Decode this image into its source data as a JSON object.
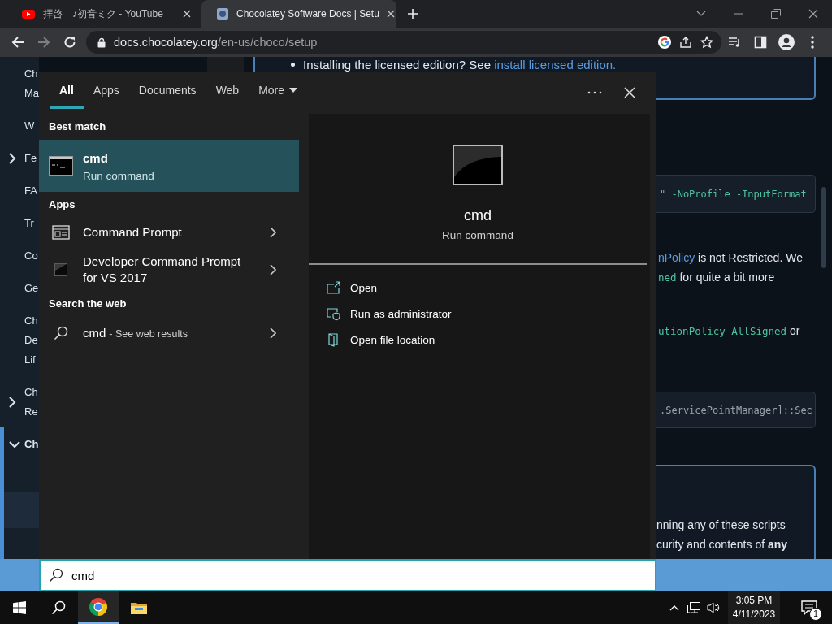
{
  "browser": {
    "tabs": [
      {
        "title": "拝啓　♪初音ミク - YouTube",
        "selected": false
      },
      {
        "title": "Chocolatey Software Docs | Setu",
        "selected": true
      }
    ],
    "forward_disabled": true,
    "address": {
      "host": "docs.chocolatey.org",
      "path": "/en-us/choco/setup"
    }
  },
  "page": {
    "sidebar": [
      {
        "lines": [
          "Ch",
          "Ma"
        ]
      },
      {
        "lines": [
          "W"
        ]
      },
      {
        "lines": [
          "Fe"
        ],
        "expanded": false
      },
      {
        "lines": [
          "FA"
        ]
      },
      {
        "lines": [
          "Tr"
        ]
      },
      {
        "lines": [
          "Co"
        ]
      },
      {
        "lines": [
          "Ge"
        ]
      },
      {
        "lines": [
          "Ch",
          "De",
          "Lif"
        ]
      },
      {
        "lines": [
          "Ch",
          "Re"
        ],
        "expanded": false
      },
      {
        "lines": [
          "Ch"
        ],
        "expanded": true
      }
    ],
    "bullet": [
      {
        "text": "Installing the licensed edition? See ",
        "kind": "plain"
      },
      {
        "text": "install licensed edition.",
        "kind": "link"
      }
    ],
    "blocks": [
      {
        "kind": "callout_end"
      },
      {
        "kind": "code",
        "text": "\" -NoProfile -InputFormat",
        "dim": false
      },
      {
        "kind": "paragraph",
        "lines": [
          [
            {
              "text": "nPolicy",
              "kind": "link"
            },
            {
              "text": " is not Restricted. We",
              "kind": "plain"
            }
          ],
          [
            {
              "text": "ned",
              "kind": "code"
            },
            {
              "text": " for quite a bit more",
              "kind": "plain"
            }
          ]
        ]
      },
      {
        "kind": "paragraph",
        "lines": [
          [
            {
              "text": "utionPolicy AllSigned",
              "kind": "code"
            },
            {
              "text": " or",
              "kind": "plain"
            }
          ]
        ]
      },
      {
        "kind": "code",
        "text": ".ServicePointManager]::Sec",
        "dim": true
      },
      {
        "kind": "callout_start",
        "lines": [
          [
            {
              "text": "nning any of these scripts",
              "kind": "plain"
            }
          ],
          [
            {
              "text": "curity and contents of ",
              "kind": "plain"
            },
            {
              "text": "any",
              "kind": "bold"
            }
          ]
        ]
      }
    ]
  },
  "search_panel": {
    "tabs": [
      {
        "label": "All",
        "selected": true,
        "dropdown": false
      },
      {
        "label": "Apps",
        "selected": false,
        "dropdown": false
      },
      {
        "label": "Documents",
        "selected": false,
        "dropdown": false
      },
      {
        "label": "Web",
        "selected": false,
        "dropdown": false
      },
      {
        "label": "More",
        "selected": false,
        "dropdown": true
      }
    ],
    "sections": [
      {
        "heading": "Best match",
        "items": [
          {
            "kind": "best",
            "title": "cmd",
            "subtitle": "Run command",
            "selected": true
          }
        ]
      },
      {
        "heading": "Apps",
        "items": [
          {
            "kind": "app",
            "title": "Command Prompt",
            "selected": false
          },
          {
            "kind": "app",
            "title": "Developer Command Prompt for VS 2017",
            "selected": false
          }
        ]
      },
      {
        "heading": "Search the web",
        "items": [
          {
            "kind": "web",
            "title": "cmd",
            "subtitle": "- See web results",
            "selected": false
          }
        ]
      }
    ],
    "preview": {
      "title": "cmd",
      "subtitle": "Run command",
      "actions": [
        {
          "label": "Open"
        },
        {
          "label": "Run as administrator"
        },
        {
          "label": "Open file location"
        }
      ]
    }
  },
  "search_box": {
    "value": "cmd"
  },
  "taskbar": {
    "apps": [
      {
        "kind": "browser",
        "active": true
      },
      {
        "kind": "folder",
        "active": false
      }
    ],
    "time": "3:05 PM",
    "date": "4/11/2023",
    "notifications": "1"
  }
}
